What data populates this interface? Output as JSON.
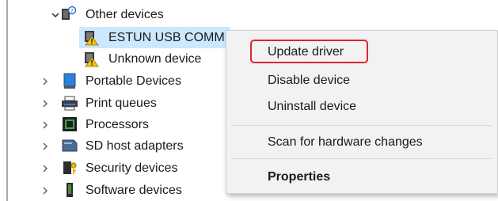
{
  "tree": {
    "other_devices": {
      "label": "Other devices",
      "icon": "warning-device-icon"
    },
    "children": [
      {
        "label": "ESTUN USB COMM",
        "icon": "warning-device-icon",
        "selected": true
      },
      {
        "label": "Unknown device",
        "icon": "warning-device-icon"
      }
    ],
    "categories": [
      {
        "label": "Portable Devices",
        "icon": "portable-device-icon"
      },
      {
        "label": "Print queues",
        "icon": "printer-icon"
      },
      {
        "label": "Processors",
        "icon": "processor-icon"
      },
      {
        "label": "SD host adapters",
        "icon": "sd-card-icon"
      },
      {
        "label": "Security devices",
        "icon": "security-device-icon"
      },
      {
        "label": "Software devices",
        "icon": "software-device-icon"
      }
    ]
  },
  "context_menu": {
    "update_driver": "Update driver",
    "disable_device": "Disable device",
    "uninstall_device": "Uninstall device",
    "scan_hardware": "Scan for hardware changes",
    "properties": "Properties"
  },
  "colors": {
    "selection": "#cce8ff",
    "highlight_box": "#d9262e",
    "menu_bg": "#f2f2f2"
  }
}
